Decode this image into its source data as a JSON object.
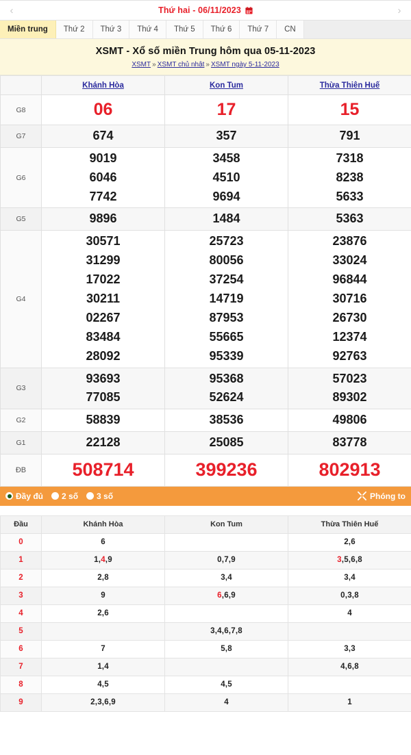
{
  "datebar": {
    "prev_label": "‹",
    "next_label": "›",
    "date_text": "Thứ hai -  06/11/2023",
    "calendar_icon": "calendar-icon",
    "calendar_color": "#e8202a"
  },
  "tabs": [
    {
      "label": "Miền trung",
      "active": true
    },
    {
      "label": "Thứ 2",
      "active": false
    },
    {
      "label": "Thứ 3",
      "active": false
    },
    {
      "label": "Thứ 4",
      "active": false
    },
    {
      "label": "Thứ 5",
      "active": false
    },
    {
      "label": "Thứ 6",
      "active": false
    },
    {
      "label": "Thứ 7",
      "active": false
    },
    {
      "label": "CN",
      "active": false
    }
  ],
  "header": {
    "title": "XSMT - Xổ số miền Trung hôm qua 05-11-2023",
    "breadcrumb": [
      "XSMT",
      "XSMT chủ nhật",
      "XSMT ngày 5-11-2023"
    ],
    "breadcrumb_separator": "»"
  },
  "results": {
    "prize_column_header": "",
    "provinces": [
      "Khánh Hòa",
      "Kon Tum",
      "Thừa Thiên Huế"
    ],
    "rows": [
      {
        "prize": "G8",
        "style": "g8",
        "values": [
          [
            "06"
          ],
          [
            "17"
          ],
          [
            "15"
          ]
        ]
      },
      {
        "prize": "G7",
        "style": "normal",
        "values": [
          [
            "674"
          ],
          [
            "357"
          ],
          [
            "791"
          ]
        ]
      },
      {
        "prize": "G6",
        "style": "normal",
        "values": [
          [
            "9019",
            "6046",
            "7742"
          ],
          [
            "3458",
            "4510",
            "9694"
          ],
          [
            "7318",
            "8238",
            "5633"
          ]
        ]
      },
      {
        "prize": "G5",
        "style": "normal",
        "values": [
          [
            "9896"
          ],
          [
            "1484"
          ],
          [
            "5363"
          ]
        ]
      },
      {
        "prize": "G4",
        "style": "normal",
        "values": [
          [
            "30571",
            "31299",
            "17022",
            "30211",
            "02267",
            "83484",
            "28092"
          ],
          [
            "25723",
            "80056",
            "37254",
            "14719",
            "87953",
            "55665",
            "95339"
          ],
          [
            "23876",
            "33024",
            "96844",
            "30716",
            "26730",
            "12374",
            "92763"
          ]
        ]
      },
      {
        "prize": "G3",
        "style": "normal",
        "values": [
          [
            "93693",
            "77085"
          ],
          [
            "95368",
            "52624"
          ],
          [
            "57023",
            "89302"
          ]
        ]
      },
      {
        "prize": "G2",
        "style": "normal",
        "values": [
          [
            "58839"
          ],
          [
            "38536"
          ],
          [
            "49806"
          ]
        ]
      },
      {
        "prize": "G1",
        "style": "normal",
        "values": [
          [
            "22128"
          ],
          [
            "25085"
          ],
          [
            "83778"
          ]
        ]
      },
      {
        "prize": "ĐB",
        "style": "db",
        "values": [
          [
            "508714"
          ],
          [
            "399236"
          ],
          [
            "802913"
          ]
        ]
      }
    ]
  },
  "toolbar": {
    "options": [
      {
        "label": "Đầy đủ",
        "selected": true
      },
      {
        "label": "2 số",
        "selected": false
      },
      {
        "label": "3 số",
        "selected": false
      }
    ],
    "zoom_label": "Phóng to",
    "zoom_icon": "expand-icon",
    "background_color": "#f49a3d"
  },
  "summary": {
    "head_label": "Đầu",
    "provinces": [
      "Khánh Hòa",
      "Kon Tum",
      "Thừa Thiên Huế"
    ],
    "rows": [
      {
        "dau": "0",
        "cells": [
          [
            {
              "d": "6",
              "hot": false
            }
          ],
          [],
          [
            {
              "d": "2",
              "hot": false
            },
            {
              "d": "6",
              "hot": false
            }
          ]
        ]
      },
      {
        "dau": "1",
        "cells": [
          [
            {
              "d": "1",
              "hot": false
            },
            {
              "d": "4",
              "hot": true
            },
            {
              "d": "9",
              "hot": false
            }
          ],
          [
            {
              "d": "0",
              "hot": false
            },
            {
              "d": "7",
              "hot": false
            },
            {
              "d": "9",
              "hot": false
            }
          ],
          [
            {
              "d": "3",
              "hot": true
            },
            {
              "d": "5",
              "hot": false
            },
            {
              "d": "6",
              "hot": false
            },
            {
              "d": "8",
              "hot": false
            }
          ]
        ]
      },
      {
        "dau": "2",
        "cells": [
          [
            {
              "d": "2",
              "hot": false
            },
            {
              "d": "8",
              "hot": false
            }
          ],
          [
            {
              "d": "3",
              "hot": false
            },
            {
              "d": "4",
              "hot": false
            }
          ],
          [
            {
              "d": "3",
              "hot": false
            },
            {
              "d": "4",
              "hot": false
            }
          ]
        ]
      },
      {
        "dau": "3",
        "cells": [
          [
            {
              "d": "9",
              "hot": false
            }
          ],
          [
            {
              "d": "6",
              "hot": true
            },
            {
              "d": "6",
              "hot": false
            },
            {
              "d": "9",
              "hot": false
            }
          ],
          [
            {
              "d": "0",
              "hot": false
            },
            {
              "d": "3",
              "hot": false
            },
            {
              "d": "8",
              "hot": false
            }
          ]
        ]
      },
      {
        "dau": "4",
        "cells": [
          [
            {
              "d": "2",
              "hot": false
            },
            {
              "d": "6",
              "hot": false
            }
          ],
          [],
          [
            {
              "d": "4",
              "hot": false
            }
          ]
        ]
      },
      {
        "dau": "5",
        "cells": [
          [],
          [
            {
              "d": "3",
              "hot": false
            },
            {
              "d": "4",
              "hot": false
            },
            {
              "d": "6",
              "hot": false
            },
            {
              "d": "7",
              "hot": false
            },
            {
              "d": "8",
              "hot": false
            }
          ],
          []
        ]
      },
      {
        "dau": "6",
        "cells": [
          [
            {
              "d": "7",
              "hot": false
            }
          ],
          [
            {
              "d": "5",
              "hot": false
            },
            {
              "d": "8",
              "hot": false
            }
          ],
          [
            {
              "d": "3",
              "hot": false
            },
            {
              "d": "3",
              "hot": false
            }
          ]
        ]
      },
      {
        "dau": "7",
        "cells": [
          [
            {
              "d": "1",
              "hot": false
            },
            {
              "d": "4",
              "hot": false
            }
          ],
          [],
          [
            {
              "d": "4",
              "hot": false
            },
            {
              "d": "6",
              "hot": false
            },
            {
              "d": "8",
              "hot": false
            }
          ]
        ]
      },
      {
        "dau": "8",
        "cells": [
          [
            {
              "d": "4",
              "hot": false
            },
            {
              "d": "5",
              "hot": false
            }
          ],
          [
            {
              "d": "4",
              "hot": false
            },
            {
              "d": "5",
              "hot": false
            }
          ],
          []
        ]
      },
      {
        "dau": "9",
        "cells": [
          [
            {
              "d": "2",
              "hot": false
            },
            {
              "d": "3",
              "hot": false
            },
            {
              "d": "6",
              "hot": false
            },
            {
              "d": "9",
              "hot": false
            }
          ],
          [
            {
              "d": "4",
              "hot": false
            }
          ],
          [
            {
              "d": "1",
              "hot": false
            }
          ]
        ]
      }
    ]
  }
}
